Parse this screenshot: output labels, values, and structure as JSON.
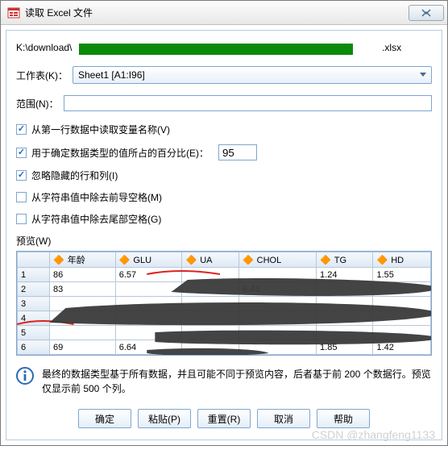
{
  "title": "读取 Excel 文件",
  "filepath_prefix": "K:\\download\\",
  "filepath_suffix": ".xlsx",
  "worksheet_label": "工作表(K)：",
  "worksheet_value": "Sheet1 [A1:I96]",
  "range_label": "范围(N)：",
  "range_value": "",
  "checkboxes": [
    {
      "label": "从第一行数据中读取变量名称(V)",
      "checked": true
    },
    {
      "label": "用于确定数据类型的值所占的百分比(E)：",
      "checked": true,
      "pct": "95"
    },
    {
      "label": "忽略隐藏的行和列(I)",
      "checked": true
    },
    {
      "label": "从字符串值中除去前导空格(M)",
      "checked": false
    },
    {
      "label": "从字符串值中除去尾部空格(G)",
      "checked": false
    }
  ],
  "preview_label": "预览(W)",
  "columns": [
    "年龄",
    "GLU",
    "UA",
    "CHOL",
    "TG",
    "HD"
  ],
  "rows": [
    [
      "1",
      "86",
      "6.57",
      "",
      "",
      "1.24",
      "1.55"
    ],
    [
      "2",
      "83",
      "",
      "",
      "6.43",
      "",
      ""
    ],
    [
      "3",
      "",
      "",
      "",
      "",
      "",
      ""
    ],
    [
      "4",
      "",
      "",
      "",
      "",
      "",
      ""
    ],
    [
      "5",
      "",
      "",
      "",
      "",
      "",
      ""
    ],
    [
      "6",
      "69",
      "6.64",
      "",
      "",
      "1.85",
      "1.42"
    ]
  ],
  "info_text": "最终的数据类型基于所有数据，并且可能不同于预览内容，后者基于前 200 个数据行。预览仅显示前 500 个列。",
  "buttons": {
    "ok": "确定",
    "paste": "粘贴(P)",
    "reset": "重置(R)",
    "cancel": "取消",
    "help": "帮助"
  },
  "watermark": "CSDN @zhangfeng1133"
}
